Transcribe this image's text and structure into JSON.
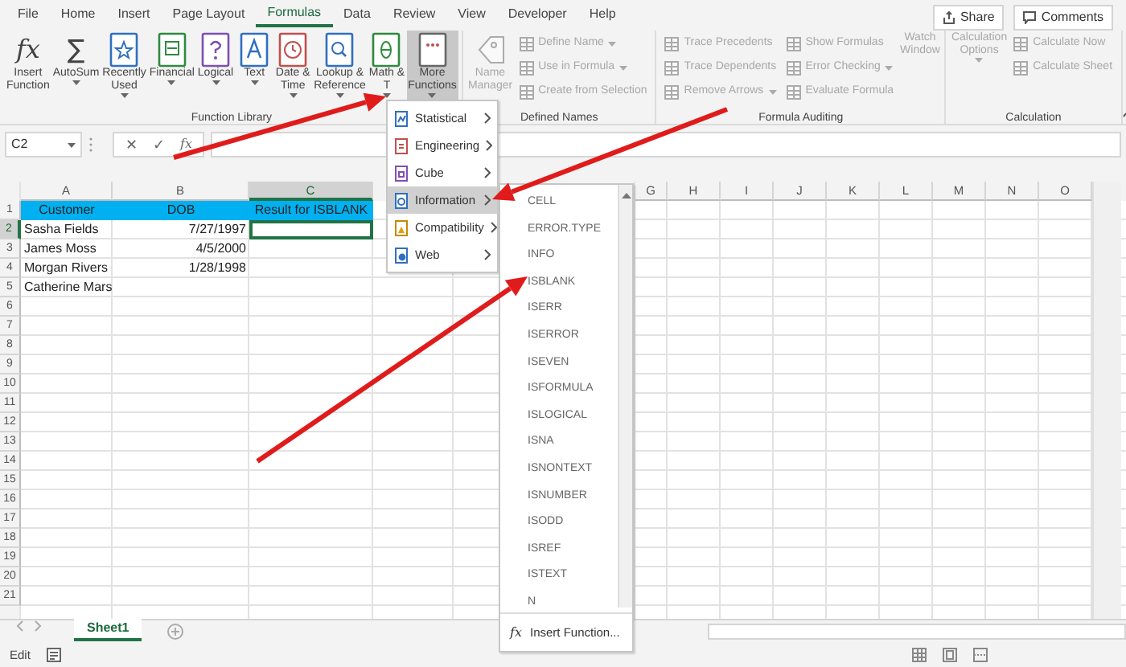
{
  "ribbon_tabs": [
    {
      "label": "File",
      "selected": false
    },
    {
      "label": "Home",
      "selected": false
    },
    {
      "label": "Insert",
      "selected": false
    },
    {
      "label": "Page Layout",
      "selected": false
    },
    {
      "label": "Formulas",
      "selected": true
    },
    {
      "label": "Data",
      "selected": false
    },
    {
      "label": "Review",
      "selected": false
    },
    {
      "label": "View",
      "selected": false
    },
    {
      "label": "Developer",
      "selected": false
    },
    {
      "label": "Help",
      "selected": false
    }
  ],
  "share_button": "Share",
  "comments_button": "Comments",
  "ribbon_groups": [
    {
      "label": "Function Library",
      "items": [
        {
          "kind": "large",
          "lines": [
            "Insert",
            "Function"
          ],
          "icon_text": "fx",
          "dropdown": false,
          "disabled": false,
          "selected": false
        },
        {
          "kind": "large",
          "lines": [
            "AutoSum"
          ],
          "icon_text": "∑",
          "dropdown": true,
          "disabled": false,
          "selected": false
        },
        {
          "kind": "large",
          "lines": [
            "Recently",
            "Used"
          ],
          "dropdown": true,
          "disabled": false,
          "selected": false
        },
        {
          "kind": "large",
          "lines": [
            "Financial"
          ],
          "dropdown": true,
          "disabled": false,
          "selected": false
        },
        {
          "kind": "large",
          "lines": [
            "Logical"
          ],
          "dropdown": true,
          "disabled": false,
          "selected": false
        },
        {
          "kind": "large",
          "lines": [
            "Text"
          ],
          "dropdown": true,
          "disabled": false,
          "selected": false
        },
        {
          "kind": "large",
          "lines": [
            "Date &",
            "Time"
          ],
          "dropdown": true,
          "disabled": false,
          "selected": false
        },
        {
          "kind": "large",
          "lines": [
            "Lookup &",
            "Reference"
          ],
          "dropdown": true,
          "disabled": false,
          "selected": false
        },
        {
          "kind": "large",
          "lines": [
            "Math &",
            "T"
          ],
          "dropdown": true,
          "disabled": false,
          "selected": false
        },
        {
          "kind": "large",
          "lines": [
            "More",
            "Functions"
          ],
          "dropdown": true,
          "disabled": false,
          "selected": true
        }
      ]
    },
    {
      "label": "Defined Names",
      "items": [
        {
          "kind": "large",
          "lines": [
            "Name",
            "Manager"
          ],
          "dropdown": false,
          "disabled": true,
          "selected": false
        },
        {
          "kind": "small",
          "lines": [
            "Define Name"
          ],
          "dropdown": true,
          "disabled": true,
          "selected": false
        },
        {
          "kind": "small",
          "lines": [
            "Use in Formula"
          ],
          "dropdown": true,
          "disabled": true,
          "selected": false
        },
        {
          "kind": "small",
          "lines": [
            "Create from Selection"
          ],
          "dropdown": false,
          "disabled": true,
          "selected": false
        }
      ]
    },
    {
      "label": "Formula Auditing",
      "items": [
        {
          "kind": "small",
          "lines": [
            "Trace Precedents"
          ],
          "dropdown": false,
          "disabled": true,
          "selected": false
        },
        {
          "kind": "small",
          "lines": [
            "Trace Dependents"
          ],
          "dropdown": false,
          "disabled": true,
          "selected": false
        },
        {
          "kind": "small",
          "lines": [
            "Remove Arrows"
          ],
          "dropdown": true,
          "disabled": true,
          "selected": false
        },
        {
          "kind": "small",
          "lines": [
            "Show Formulas"
          ],
          "dropdown": false,
          "disabled": true,
          "selected": false
        },
        {
          "kind": "small",
          "lines": [
            "Error Checking"
          ],
          "dropdown": true,
          "disabled": true,
          "selected": false
        },
        {
          "kind": "small",
          "lines": [
            "Evaluate Formula"
          ],
          "dropdown": false,
          "disabled": true,
          "selected": false
        },
        {
          "kind": "large",
          "lines": [
            "Watch",
            "Window"
          ],
          "dropdown": false,
          "disabled": true,
          "selected": false
        }
      ]
    },
    {
      "label": "Calculation",
      "items": [
        {
          "kind": "large",
          "lines": [
            "Calculation",
            "Options"
          ],
          "dropdown": true,
          "disabled": true,
          "selected": false
        },
        {
          "kind": "small",
          "lines": [
            "Calculate Now"
          ],
          "dropdown": false,
          "disabled": true,
          "selected": false
        },
        {
          "kind": "small",
          "lines": [
            "Calculate Sheet"
          ],
          "dropdown": false,
          "disabled": true,
          "selected": false
        }
      ]
    }
  ],
  "formula_bar": {
    "name_box": "C2",
    "cancel": "✕",
    "enter": "✓",
    "function": "fx"
  },
  "sheet": {
    "columns": [
      {
        "label": "A",
        "selected": false
      },
      {
        "label": "B",
        "selected": false
      },
      {
        "label": "C",
        "selected": true
      },
      {
        "label": "G",
        "selected": false
      },
      {
        "label": "H",
        "selected": false
      },
      {
        "label": "I",
        "selected": false
      },
      {
        "label": "J",
        "selected": false
      },
      {
        "label": "K",
        "selected": false
      },
      {
        "label": "L",
        "selected": false
      },
      {
        "label": "M",
        "selected": false
      },
      {
        "label": "N",
        "selected": false
      },
      {
        "label": "O",
        "selected": false
      }
    ],
    "rows": [
      {
        "number": "1",
        "selected": false,
        "cells": [
          {
            "kind": "heading",
            "text": "Customer",
            "selected": false
          },
          {
            "kind": "heading",
            "text": "DOB",
            "selected": false
          },
          {
            "kind": "heading",
            "text": "Result for ISBLANK",
            "selected": false
          }
        ]
      },
      {
        "number": "2",
        "selected": true,
        "cells": [
          {
            "kind": "text",
            "text": "Sasha Fields",
            "selected": false
          },
          {
            "kind": "date",
            "text": "7/27/1997",
            "selected": false
          },
          {
            "kind": "text",
            "selected": true
          }
        ]
      },
      {
        "number": "3",
        "selected": false,
        "cells": [
          {
            "kind": "text",
            "text": "James Moss",
            "selected": false
          },
          {
            "kind": "date",
            "text": "4/5/2000",
            "selected": false
          }
        ]
      },
      {
        "number": "4",
        "selected": false,
        "cells": [
          {
            "kind": "text",
            "text": "Morgan  Rivers",
            "selected": false
          },
          {
            "kind": "date",
            "text": "1/28/1998",
            "selected": false
          }
        ]
      },
      {
        "number": "5",
        "selected": false,
        "cells": [
          {
            "kind": "text",
            "text": "Catherine Mars",
            "selected": false
          }
        ]
      },
      {
        "number": "6",
        "selected": false
      },
      {
        "number": "7",
        "selected": false
      },
      {
        "number": "8",
        "selected": false
      },
      {
        "number": "9",
        "selected": false
      },
      {
        "number": "10",
        "selected": false
      },
      {
        "number": "11",
        "selected": false
      },
      {
        "number": "12",
        "selected": false
      },
      {
        "number": "13",
        "selected": false
      },
      {
        "number": "14",
        "selected": false
      },
      {
        "number": "15",
        "selected": false
      },
      {
        "number": "16",
        "selected": false
      },
      {
        "number": "17",
        "selected": false
      },
      {
        "number": "18",
        "selected": false
      },
      {
        "number": "19",
        "selected": false
      },
      {
        "number": "20",
        "selected": false
      },
      {
        "number": "21",
        "selected": false
      }
    ]
  },
  "more_functions_menu": [
    {
      "label": "Statistical",
      "selected": false
    },
    {
      "label": "Engineering",
      "selected": false
    },
    {
      "label": "Cube",
      "selected": false
    },
    {
      "label": "Information",
      "selected": true
    },
    {
      "label": "Compatibility",
      "selected": false
    },
    {
      "label": "Web",
      "selected": false
    }
  ],
  "information_submenu": {
    "items": [
      "CELL",
      "ERROR.TYPE",
      "INFO",
      "ISBLANK",
      "ISERR",
      "ISERROR",
      "ISEVEN",
      "ISFORMULA",
      "ISLOGICAL",
      "ISNA",
      "ISNONTEXT",
      "ISNUMBER",
      "ISODD",
      "ISREF",
      "ISTEXT",
      "N"
    ],
    "footer_icon": "fx",
    "footer": "Insert Function..."
  },
  "sheet_tabs": [
    {
      "label": "Sheet1",
      "selected": true
    }
  ],
  "status_bar": {
    "mode": "Edit"
  }
}
